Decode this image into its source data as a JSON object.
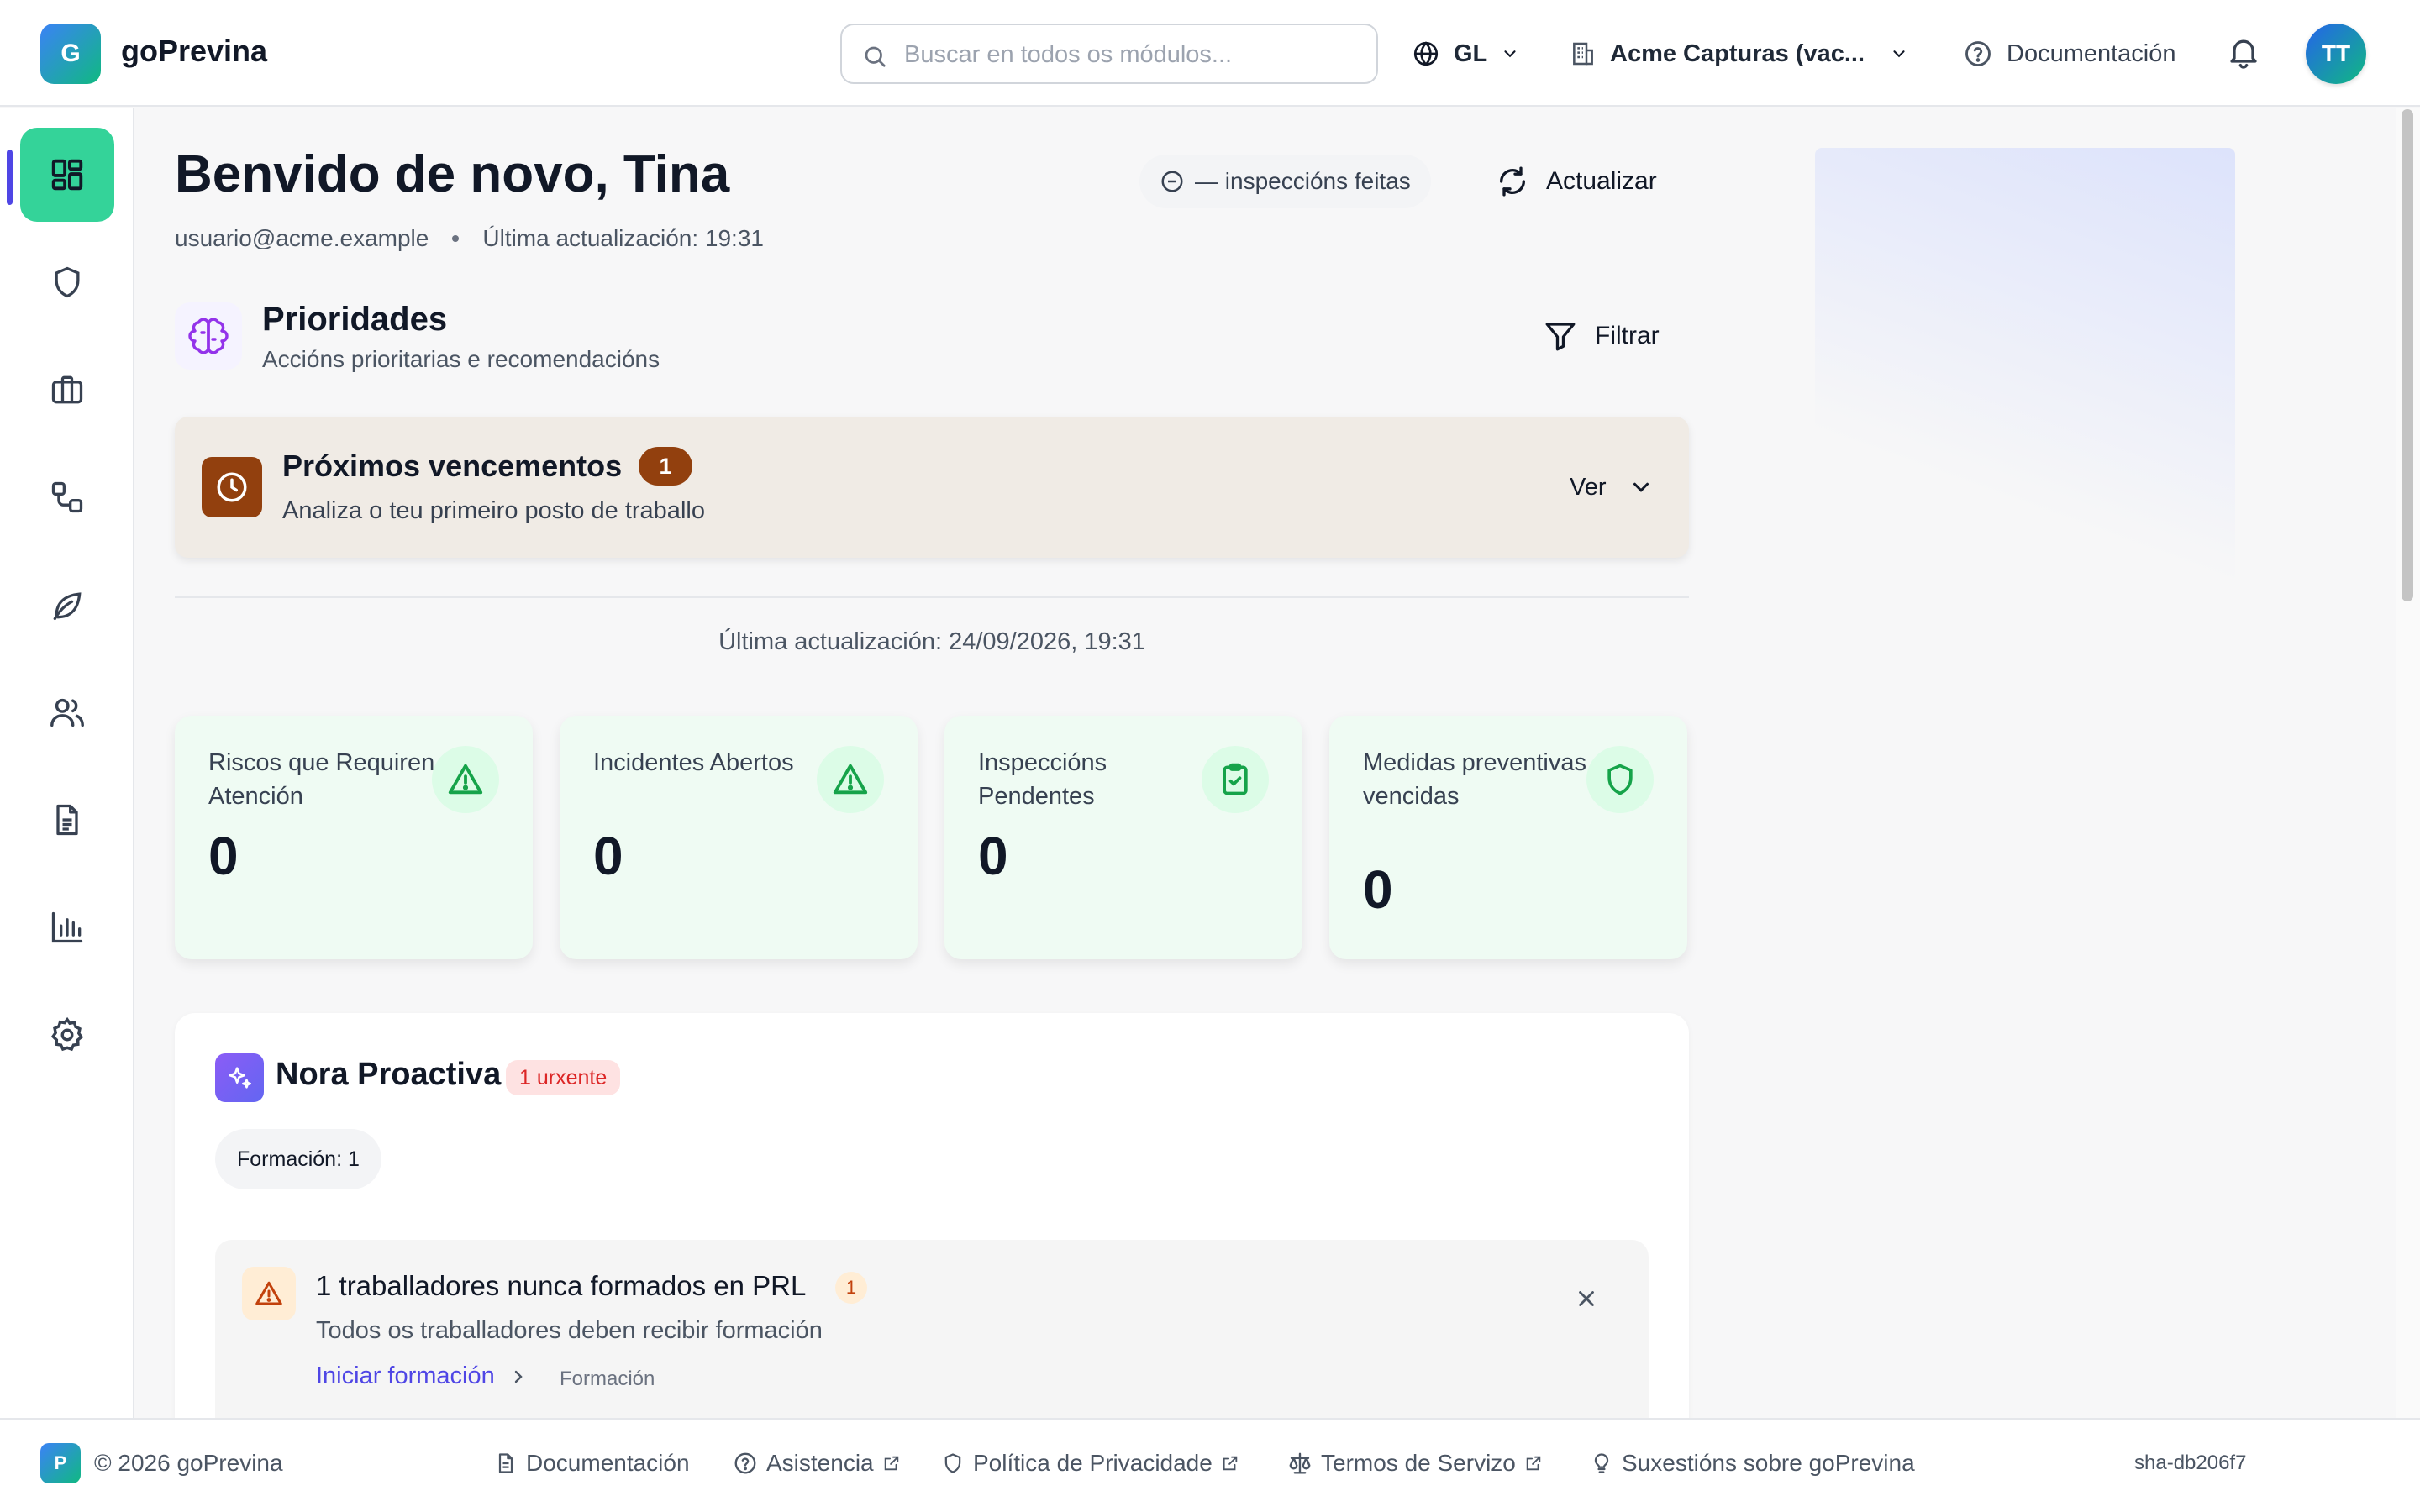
{
  "header": {
    "logo_letter": "G",
    "brand": "goPrevina",
    "search_placeholder": "Buscar en todos os módulos...",
    "language": "GL",
    "company": "Acme Capturas (vac...",
    "docs": "Documentación",
    "avatar_initials": "TT"
  },
  "sidebar": {
    "items": [
      {
        "icon": "dashboard-icon",
        "active": true
      },
      {
        "icon": "shield-icon"
      },
      {
        "icon": "briefcase-icon"
      },
      {
        "icon": "workflow-icon"
      },
      {
        "icon": "leaf-icon"
      },
      {
        "icon": "users-icon"
      },
      {
        "icon": "document-icon"
      },
      {
        "icon": "bar-chart-icon"
      },
      {
        "icon": "settings-icon"
      }
    ]
  },
  "page": {
    "title": "Benvido de novo, Tina",
    "email": "usuario@acme.example",
    "last_update_short": "Última actualización: 19:31",
    "inspections_pill": "— inspeccións feitas",
    "refresh": "Actualizar"
  },
  "priorities": {
    "title": "Prioridades",
    "subtitle": "Accións prioritarias e recomendacións",
    "filter": "Filtrar"
  },
  "due": {
    "title": "Próximos vencementos",
    "count": "1",
    "subtitle": "Analiza o teu primeiro posto de traballo",
    "view": "Ver"
  },
  "last_update_full": "Última actualización: 24/09/2026, 19:31",
  "stats": [
    {
      "label": "Riscos que Requiren Atención",
      "value": "0",
      "icon": "warning-icon"
    },
    {
      "label": "Incidentes Abertos",
      "value": "0",
      "icon": "warning-icon"
    },
    {
      "label": "Inspeccións Pendentes",
      "value": "0",
      "icon": "clipboard-check-icon"
    },
    {
      "label": "Medidas preventivas vencidas",
      "value": "0",
      "icon": "shield-icon"
    }
  ],
  "nora": {
    "title": "Nora Proactiva",
    "urgent": "1 urxente",
    "chip": "Formación: 1",
    "alert": {
      "title": "1 traballadores nunca formados en PRL",
      "badge": "1",
      "subtitle": "Todos os traballadores deben recibir formación",
      "action": "Iniciar formación",
      "tag": "Formación"
    }
  },
  "footer": {
    "logo_letter": "P",
    "copyright": "© 2026 goPrevina",
    "links": [
      "Documentación",
      "Asistencia",
      "Política de Privacidade",
      "Termos de Servizo",
      "Suxestións sobre goPrevina"
    ],
    "sha": "sha-db206f7"
  },
  "colors": {
    "accent": "#34d399",
    "indicator": "#4f46e5",
    "due_brown": "#92400e",
    "stat_green": "#16a34a",
    "link": "#4f46e5",
    "urgent_red": "#dc2626"
  }
}
